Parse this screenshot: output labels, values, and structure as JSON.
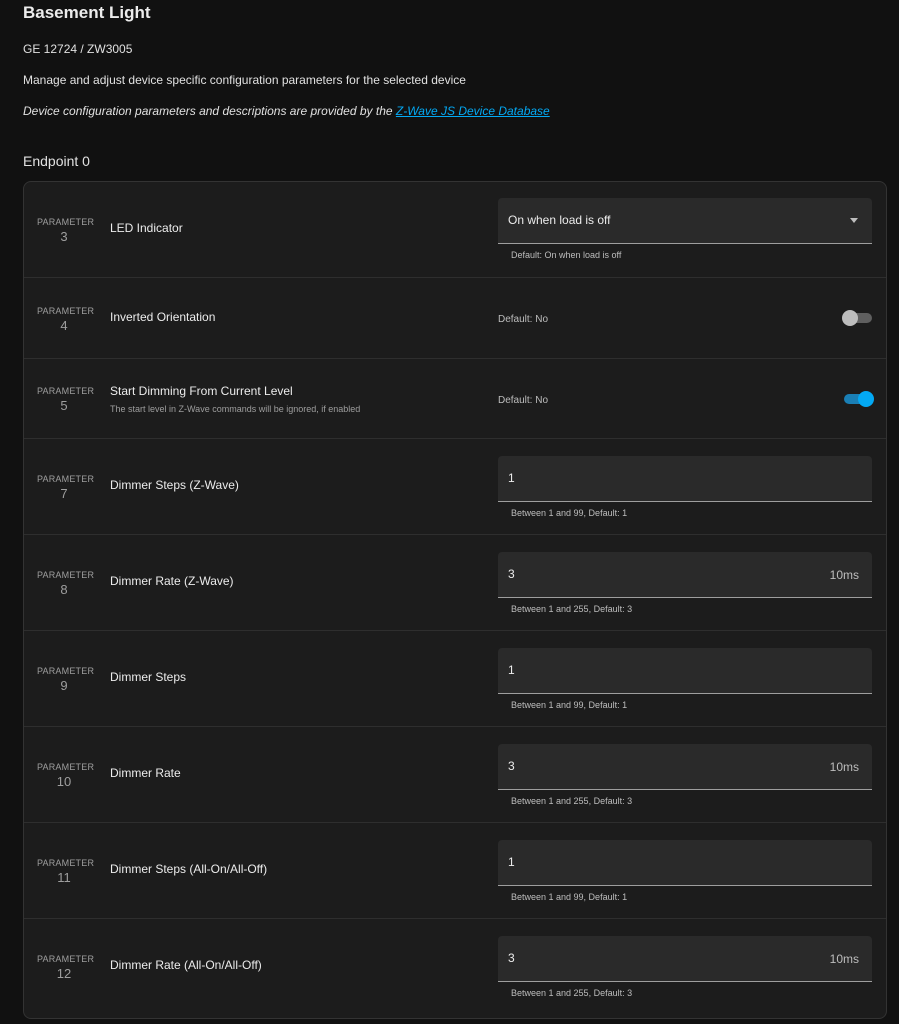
{
  "header": {
    "title": "Basement Light",
    "model": "GE 12724 / ZW3005",
    "description": "Manage and adjust device specific configuration parameters for the selected device",
    "credit_prefix": "Device configuration parameters and descriptions are provided by the ",
    "credit_link": "Z-Wave JS Device Database",
    "endpoint": "Endpoint 0"
  },
  "param_label": "PARAMETER",
  "params": [
    {
      "number": "3",
      "label": "LED Indicator",
      "type": "select",
      "value": "On when load is off",
      "helper": "Default: On when load is off"
    },
    {
      "number": "4",
      "label": "Inverted Orientation",
      "type": "toggle",
      "checked": false,
      "helper": "Default: No"
    },
    {
      "number": "5",
      "label": "Start Dimming From Current Level",
      "sublabel": "The start level in Z-Wave commands will be ignored, if enabled",
      "type": "toggle",
      "checked": true,
      "helper": "Default: No"
    },
    {
      "number": "7",
      "label": "Dimmer Steps (Z-Wave)",
      "type": "number",
      "value": "1",
      "suffix": "",
      "helper": "Between 1 and 99, Default: 1"
    },
    {
      "number": "8",
      "label": "Dimmer Rate (Z-Wave)",
      "type": "number",
      "value": "3",
      "suffix": "10ms",
      "helper": "Between 1 and 255, Default: 3"
    },
    {
      "number": "9",
      "label": "Dimmer Steps",
      "type": "number",
      "value": "1",
      "suffix": "",
      "helper": "Between 1 and 99, Default: 1"
    },
    {
      "number": "10",
      "label": "Dimmer Rate",
      "type": "number",
      "value": "3",
      "suffix": "10ms",
      "helper": "Between 1 and 255, Default: 3"
    },
    {
      "number": "11",
      "label": "Dimmer Steps (All-On/All-Off)",
      "type": "number",
      "value": "1",
      "suffix": "",
      "helper": "Between 1 and 99, Default: 1"
    },
    {
      "number": "12",
      "label": "Dimmer Rate (All-On/All-Off)",
      "type": "number",
      "value": "3",
      "suffix": "10ms",
      "helper": "Between 1 and 255, Default: 3"
    }
  ],
  "colors": {
    "background": "#111111",
    "card": "#1c1c1c",
    "accent": "#03a9f4",
    "field": "#2a2a2a"
  }
}
